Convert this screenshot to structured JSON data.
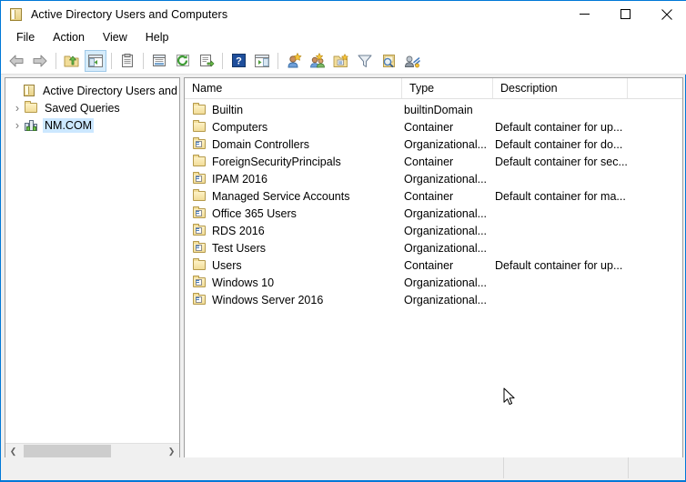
{
  "window": {
    "title": "Active Directory Users and Computers",
    "title_icon": "console-book-icon",
    "controls": {
      "minimize": "minimize-button",
      "maximize": "maximize-button",
      "close": "close-button"
    }
  },
  "menubar": {
    "items": [
      {
        "label": "File"
      },
      {
        "label": "Action"
      },
      {
        "label": "View"
      },
      {
        "label": "Help"
      }
    ]
  },
  "toolbar": {
    "buttons": [
      {
        "name": "back-icon",
        "group": 1
      },
      {
        "name": "forward-icon",
        "group": 1
      },
      {
        "name": "up-one-level-icon",
        "group": 2
      },
      {
        "name": "show-hide-console-tree-icon",
        "group": 2,
        "active": true
      },
      {
        "name": "properties-clipboard-icon",
        "group": 3
      },
      {
        "name": "properties-icon",
        "group": 4
      },
      {
        "name": "refresh-icon",
        "group": 4
      },
      {
        "name": "export-list-icon",
        "group": 4
      },
      {
        "name": "help-icon",
        "group": 5
      },
      {
        "name": "show-hide-action-pane-icon",
        "group": 5
      },
      {
        "name": "new-user-icon",
        "group": 6
      },
      {
        "name": "new-group-icon",
        "group": 6
      },
      {
        "name": "new-organizational-unit-icon",
        "group": 6
      },
      {
        "name": "filter-icon",
        "group": 6
      },
      {
        "name": "find-icon",
        "group": 6
      },
      {
        "name": "connect-to-domain-icon",
        "group": 6
      }
    ]
  },
  "tree": {
    "items": [
      {
        "label": "Active Directory Users and Com",
        "icon": "console-root-icon",
        "expander": "",
        "indent": 0,
        "selected": false
      },
      {
        "label": "Saved Queries",
        "icon": "folder-icon",
        "expander": "›",
        "indent": 1,
        "selected": false
      },
      {
        "label": "NM.COM",
        "icon": "domain-icon",
        "expander": "›",
        "indent": 1,
        "selected": true
      }
    ],
    "hscroll": {
      "left_arrow": "❮",
      "right_arrow": "❯"
    }
  },
  "listview": {
    "columns": [
      {
        "label": "Name"
      },
      {
        "label": "Type"
      },
      {
        "label": "Description"
      }
    ],
    "rows": [
      {
        "name": "Builtin",
        "type": "builtinDomain",
        "description": "",
        "icon": "folder-icon"
      },
      {
        "name": "Computers",
        "type": "Container",
        "description": "Default container for up...",
        "icon": "folder-icon"
      },
      {
        "name": "Domain Controllers",
        "type": "Organizational...",
        "description": "Default container for do...",
        "icon": "organizational-unit-icon"
      },
      {
        "name": "ForeignSecurityPrincipals",
        "type": "Container",
        "description": "Default container for sec...",
        "icon": "folder-icon"
      },
      {
        "name": "IPAM 2016",
        "type": "Organizational...",
        "description": "",
        "icon": "organizational-unit-icon"
      },
      {
        "name": "Managed Service Accounts",
        "type": "Container",
        "description": "Default container for ma...",
        "icon": "folder-icon"
      },
      {
        "name": "Office 365 Users",
        "type": "Organizational...",
        "description": "",
        "icon": "organizational-unit-icon"
      },
      {
        "name": "RDS 2016",
        "type": "Organizational...",
        "description": "",
        "icon": "organizational-unit-icon"
      },
      {
        "name": "Test Users",
        "type": "Organizational...",
        "description": "",
        "icon": "organizational-unit-icon"
      },
      {
        "name": "Users",
        "type": "Container",
        "description": "Default container for up...",
        "icon": "folder-icon"
      },
      {
        "name": "Windows 10",
        "type": "Organizational...",
        "description": "",
        "icon": "organizational-unit-icon"
      },
      {
        "name": "Windows Server 2016",
        "type": "Organizational...",
        "description": "",
        "icon": "organizational-unit-icon"
      }
    ]
  },
  "statusbar": {
    "main": "",
    "mid": "",
    "end": ""
  },
  "colors": {
    "accent": "#0078d7",
    "selection": "#cce8ff",
    "window_bg": "#f0f0f0",
    "pane_bg": "#ffffff",
    "pane_border": "#9e9e9e"
  }
}
